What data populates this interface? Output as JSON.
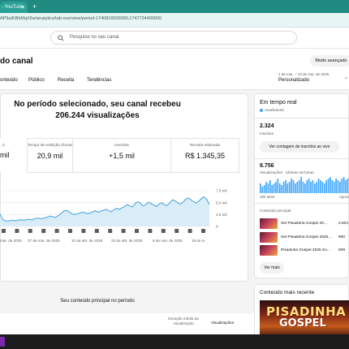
{
  "browser": {
    "tab_title": "- YouTube",
    "new_tab": "+",
    "url": "AP9aIKBbMqX5w/analytics/tab-overview/period-1740816000000,1747724400000"
  },
  "studio": {
    "search_placeholder": "Pesquise no seu canal",
    "page_title": "do canal",
    "advanced_button": "Modo avançado",
    "tabs": [
      "onteúdo",
      "Público",
      "Receita",
      "Tendências"
    ],
    "period_range": "1 de mar. – 19 de mai. de 2025",
    "period_label": "Personalizado"
  },
  "overview": {
    "headline_line1": "No período selecionado, seu canal recebeu",
    "headline_line2": "206.244 visualizações",
    "metrics": [
      {
        "label": "",
        "value": "mil"
      },
      {
        "label": "Tempo de exibição (horas)",
        "value": "20,9 mil"
      },
      {
        "label": "Inscritos",
        "value": "+1,5 mil"
      },
      {
        "label": "Receita estimada",
        "value": "R$ 1.345,35"
      }
    ],
    "top_content_title": "Seu conteúdo principal no período",
    "col_avg_duration": "Duração média da visualização",
    "col_views": "Visualizações"
  },
  "chart_data": {
    "type": "area",
    "x_labels": [
      "mar. de 2025",
      "27 de mar. de 2025",
      "10 de abr. de 2025",
      "23 de abr. de 2025",
      "6 de mai. de 2025",
      "19 de m"
    ],
    "y_ticks": [
      "7,5 mil",
      "5,0 mil",
      "2,5 mil",
      "0"
    ],
    "ylim": [
      0,
      7500
    ],
    "series": [
      {
        "values": [
          2600,
          1500,
          1200,
          1100,
          1250,
          1300,
          1200,
          1350,
          1400,
          1300,
          1450,
          1500,
          1400,
          1600,
          1750,
          1700,
          1600,
          1800,
          2000,
          2200,
          2000,
          1900,
          2300,
          2700,
          3200,
          3400,
          3100,
          2700,
          2500,
          2600,
          2800,
          3000,
          2900,
          2700,
          2800,
          3100,
          3300,
          3000,
          3200,
          3400,
          3600,
          3300,
          3100,
          3500,
          3800,
          3600,
          3900,
          4200,
          4600,
          4300,
          4100,
          4800,
          5200,
          4900,
          4300,
          4600,
          5100,
          4800,
          4500,
          4200,
          4700,
          5000,
          4600,
          4400,
          4900,
          5600,
          5400,
          5000,
          4700,
          5100,
          5700,
          6000,
          5600,
          5200,
          4900,
          5300,
          5900,
          6200,
          5700,
          4600
        ]
      }
    ],
    "grid": true
  },
  "realtime": {
    "title": "Em tempo real",
    "live_label": "Atualizando",
    "subs_value": "2.324",
    "subs_label": "Inscritos",
    "live_button": "Ver contagem de inscritos ao vivo",
    "views_value": "8.756",
    "views_label": "Visualizações · Últimas 48 horas",
    "axis_start": "48h atrás",
    "axis_end": "Agora",
    "bars": [
      6,
      4,
      5,
      7,
      6,
      8,
      5,
      6,
      7,
      9,
      6,
      5,
      7,
      8,
      6,
      7,
      9,
      8,
      6,
      7,
      8,
      10,
      7,
      6,
      8,
      9,
      7,
      8,
      6,
      7,
      9,
      8,
      7,
      6,
      8,
      9,
      10,
      8,
      7,
      9,
      8,
      7,
      9,
      10,
      8,
      9
    ],
    "content_header": "Conteúdo principal",
    "rows": [
      {
        "title": "Set Pisadinha Gospel 20...",
        "value": "2.604"
      },
      {
        "title": "Set Pisadinha Gospel 2025...",
        "value": "660"
      },
      {
        "title": "Pisadinha Gospel 2025 So...",
        "value": "609"
      }
    ],
    "more_button": "Ver mais"
  },
  "latest": {
    "title": "Conteúdo mais recente",
    "thumb_word1": "PISADINHA",
    "thumb_word2": "GOSPEL"
  },
  "colors": {
    "browser_teal": "#1f8a80",
    "chart_line": "#41a0d8",
    "chart_fill": "#d9edf8",
    "live_dot": "#3ea6ff"
  }
}
